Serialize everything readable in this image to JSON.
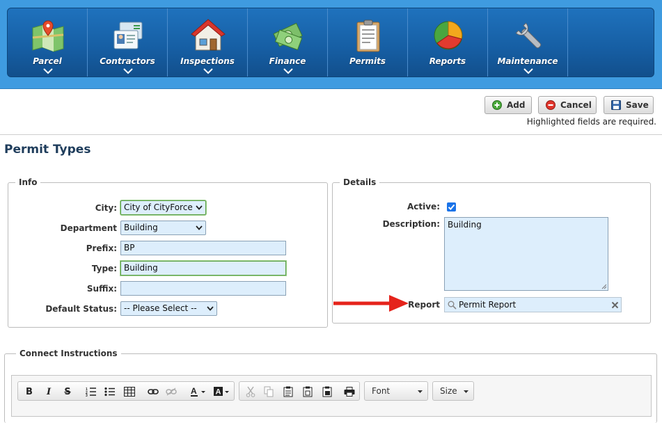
{
  "nav": {
    "items": [
      {
        "label": "Parcel",
        "icon": "map-pin-icon",
        "has_menu": true
      },
      {
        "label": "Contractors",
        "icon": "contractor-cards-icon",
        "has_menu": true
      },
      {
        "label": "Inspections",
        "icon": "house-icon",
        "has_menu": true
      },
      {
        "label": "Finance",
        "icon": "money-icon",
        "has_menu": true
      },
      {
        "label": "Permits",
        "icon": "clipboard-icon",
        "has_menu": false
      },
      {
        "label": "Reports",
        "icon": "pie-chart-icon",
        "has_menu": false
      },
      {
        "label": "Maintenance",
        "icon": "wrench-icon",
        "has_menu": true
      }
    ]
  },
  "toolbar": {
    "add_label": "Add",
    "cancel_label": "Cancel",
    "save_label": "Save",
    "required_note": "Highlighted fields are required."
  },
  "page": {
    "title": "Permit Types"
  },
  "info": {
    "legend": "Info",
    "city_label": "City:",
    "city_value": "City of CityForce",
    "department_label": "Department",
    "department_value": "Building",
    "prefix_label": "Prefix:",
    "prefix_value": "BP",
    "type_label": "Type:",
    "type_value": "Building",
    "suffix_label": "Suffix:",
    "suffix_value": "",
    "default_status_label": "Default Status:",
    "default_status_value": "-- Please Select --"
  },
  "details": {
    "legend": "Details",
    "active_label": "Active:",
    "active_checked": true,
    "description_label": "Description:",
    "description_value": "Building",
    "report_label": "Report",
    "report_value": "Permit Report"
  },
  "connect": {
    "legend": "Connect Instructions",
    "font_label": "Font",
    "size_label": "Size"
  },
  "colors": {
    "nav_bg": "#1f72bd",
    "header_bg": "#3f9be0",
    "field_bg": "#ddeefc",
    "required_border": "#5aa046",
    "arrow": "#e5231b",
    "title": "#1f3d5c"
  }
}
